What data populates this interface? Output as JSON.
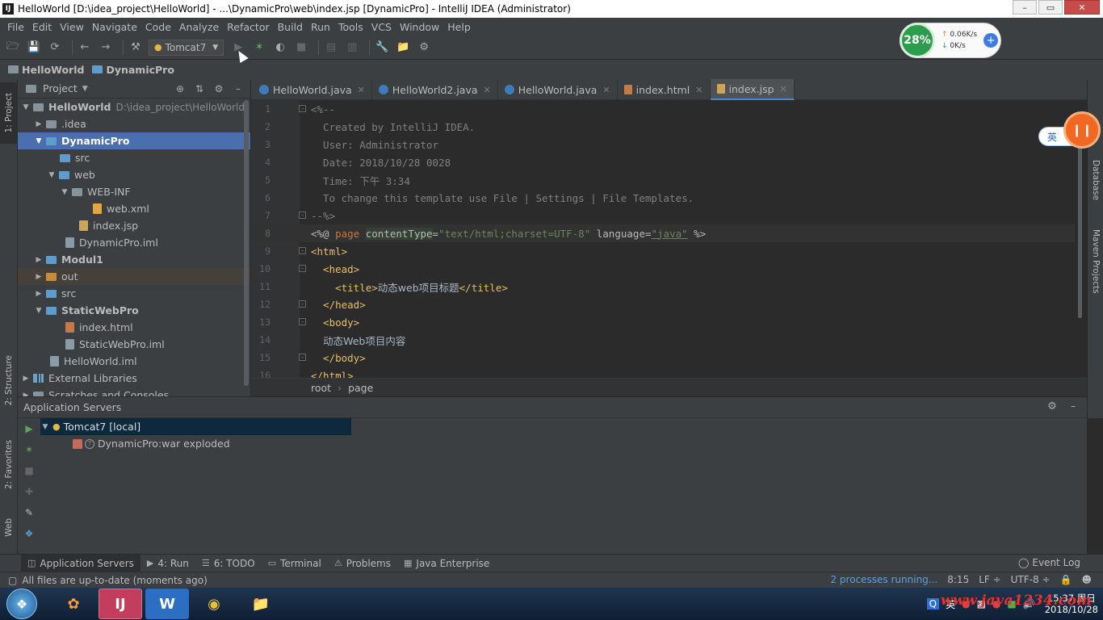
{
  "window": {
    "title": "HelloWorld [D:\\idea_project\\HelloWorld] - ...\\DynamicPro\\web\\index.jsp [DynamicPro] - IntelliJ IDEA (Administrator)",
    "app_icon": "IJ"
  },
  "menu": [
    "File",
    "Edit",
    "View",
    "Navigate",
    "Code",
    "Analyze",
    "Refactor",
    "Build",
    "Run",
    "Tools",
    "VCS",
    "Window",
    "Help"
  ],
  "toolbar": {
    "run_config": "Tomcat7"
  },
  "navbar": {
    "crumbs": [
      "HelloWorld",
      "DynamicPro"
    ]
  },
  "left_strip": {
    "tabs": [
      "1: Project",
      "2: Structure",
      "2: Favorites",
      "Web"
    ]
  },
  "right_strip": {
    "tabs": [
      "Database",
      "Maven Projects"
    ]
  },
  "project_panel": {
    "title": "Project",
    "tree": [
      {
        "label": "HelloWorld",
        "path": "D:\\idea_project\\HelloWorld"
      },
      {
        "label": ".idea"
      },
      {
        "label": "DynamicPro"
      },
      {
        "label": "src"
      },
      {
        "label": "web"
      },
      {
        "label": "WEB-INF"
      },
      {
        "label": "web.xml"
      },
      {
        "label": "index.jsp"
      },
      {
        "label": "DynamicPro.iml"
      },
      {
        "label": "Modul1"
      },
      {
        "label": "out"
      },
      {
        "label": "src"
      },
      {
        "label": "StaticWebPro"
      },
      {
        "label": "index.html"
      },
      {
        "label": "StaticWebPro.iml"
      },
      {
        "label": "HelloWorld.iml"
      },
      {
        "label": "External Libraries"
      },
      {
        "label": "Scratches and Consoles"
      }
    ]
  },
  "editor": {
    "tabs": [
      "HelloWorld.java",
      "HelloWorld2.java",
      "HelloWorld.java",
      "index.html",
      "index.jsp"
    ],
    "lines": [
      {
        "n": "1",
        "t1": "<%--"
      },
      {
        "n": "2",
        "t1": "  Created by IntelliJ IDEA."
      },
      {
        "n": "3",
        "t1": "  User: Administrator"
      },
      {
        "n": "4",
        "t1": "  Date: 2018/10/28 0028"
      },
      {
        "n": "5",
        "t1": "  Time: ",
        "t2": "下午",
        "t3": " 3:34"
      },
      {
        "n": "6",
        "t1": "  To change this template use File | Settings | File Templates."
      },
      {
        "n": "7",
        "t1": "--%>"
      },
      {
        "n": "8",
        "t1": "<%@ ",
        "t2": "page",
        "t3": " ",
        "t4": "contentType",
        "t5": "=",
        "t6": "\"text/html;charset=UTF-8\"",
        "t7": " language=",
        "t8": "\"java\"",
        "t9": " %>"
      },
      {
        "n": "9",
        "t1": "<html>"
      },
      {
        "n": "10",
        "t1": "  <head>"
      },
      {
        "n": "11",
        "t1": "    <title>",
        "t2": "动态web项目标题",
        "t3": "</title>"
      },
      {
        "n": "12",
        "t1": "  </head>"
      },
      {
        "n": "13",
        "t1": "  <body>"
      },
      {
        "n": "14",
        "t1": "  ",
        "t2": "动态Web项目内容"
      },
      {
        "n": "15",
        "t1": "  </body>"
      },
      {
        "n": "16",
        "t1": "</html>"
      }
    ],
    "breadcrumb": [
      "root",
      "page"
    ]
  },
  "bottom_panel": {
    "title": "Application Servers",
    "server": "Tomcat7 [local]",
    "artifact": "DynamicPro:war exploded"
  },
  "tool_tabs": [
    {
      "label": "Application Servers"
    },
    {
      "label": "4: Run"
    },
    {
      "label": "6: TODO"
    },
    {
      "label": "Terminal"
    },
    {
      "label": "Problems"
    },
    {
      "label": "Java Enterprise"
    }
  ],
  "event_log": "Event Log",
  "status": {
    "message": "All files are up-to-date (moments ago)",
    "processes": "2 processes running...",
    "position": "8:15",
    "line_sep": "LF ÷",
    "encoding": "UTF-8 ÷"
  },
  "net_widget": {
    "percent": "28%",
    "up": "0.06K/s",
    "down": "0K/s"
  },
  "ime": "英",
  "taskbar": {
    "tray_ime": "英",
    "time": "15:37 周日",
    "date": "2018/10/28"
  },
  "watermark": "www.java1234.com",
  "colors": {
    "accent": "#4b6eaf",
    "editor_bg": "#2b2b2b",
    "panel_bg": "#3c3f41",
    "tag": "#e8bf6a",
    "comment": "#808080",
    "string": "#6a8759"
  }
}
